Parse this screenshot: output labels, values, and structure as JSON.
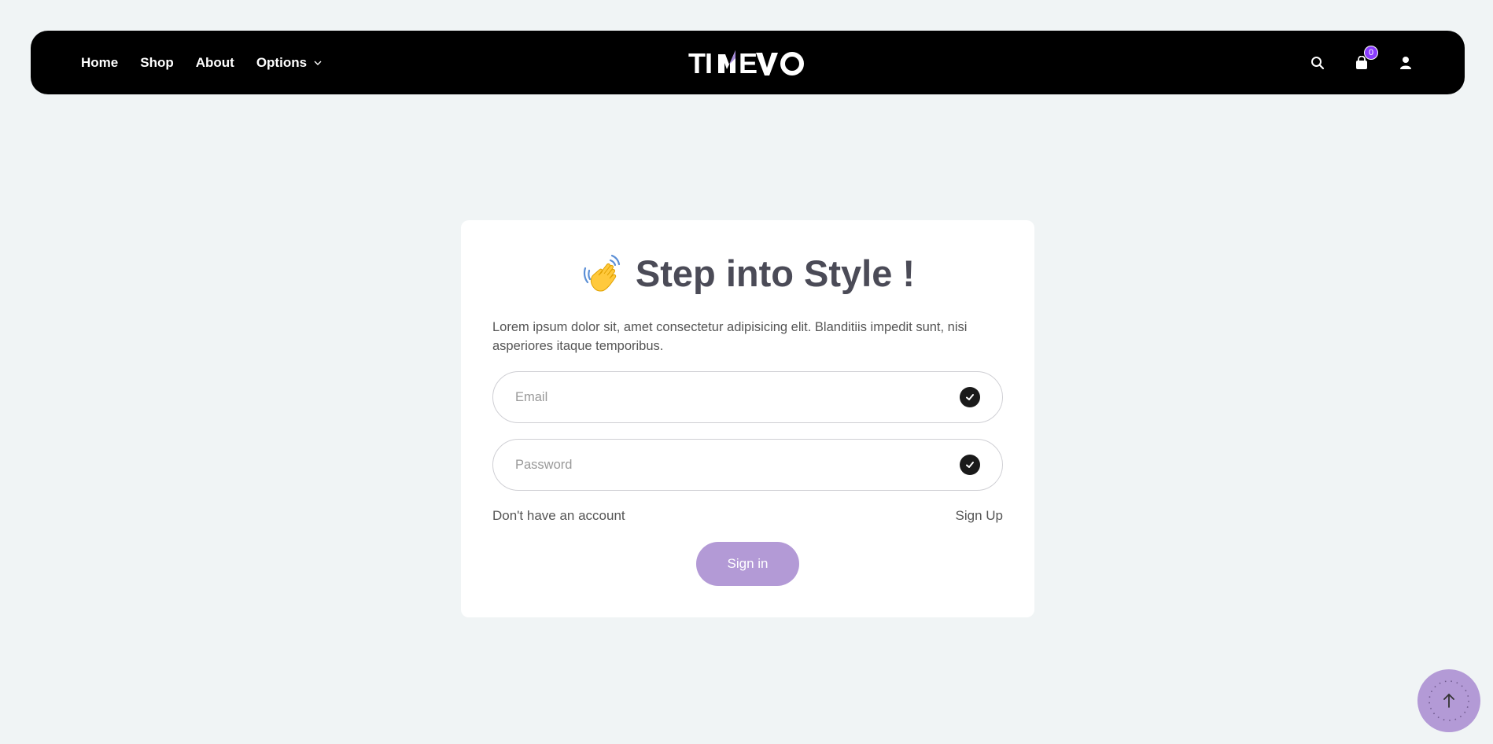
{
  "nav": {
    "links": [
      {
        "label": "Home"
      },
      {
        "label": "Shop"
      },
      {
        "label": "About"
      },
      {
        "label": "Options"
      }
    ],
    "logo_text": "TIMEVO",
    "cart_count": "0",
    "icons": [
      "search-icon",
      "cart-icon",
      "user-icon"
    ]
  },
  "login": {
    "title": "Step into Style !",
    "title_icon": "waving-hand-icon",
    "description": "Lorem ipsum dolor sit, amet consectetur adipisicing elit. Blanditiis impedit sunt, nisi asperiores itaque temporibus.",
    "email_placeholder": "Email",
    "password_placeholder": "Password",
    "no_account_text": "Don't have an account",
    "signup_label": "Sign Up",
    "signin_label": "Sign in"
  },
  "colors": {
    "accent": "#b39ad6",
    "badge": "#8b3dff",
    "nav_bg": "#000000",
    "page_bg": "#f0f4f5"
  },
  "scroll_top": {
    "icon": "arrow-up-icon"
  }
}
